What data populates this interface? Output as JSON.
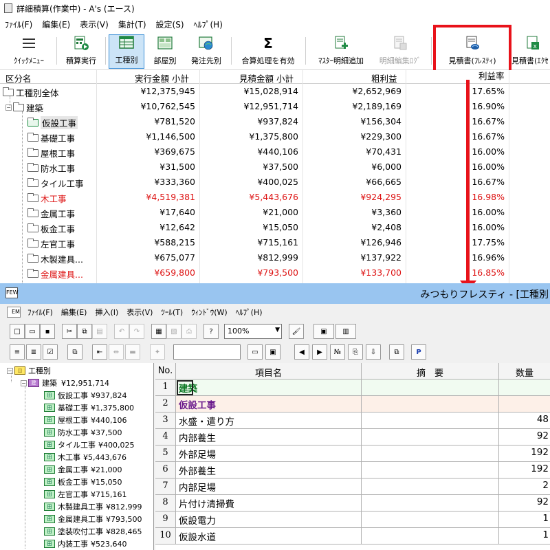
{
  "top": {
    "title": "詳細積算(作業中) - A's (エース)",
    "menu": [
      "ﾌｧｲﾙ(F)",
      "編集(E)",
      "表示(V)",
      "集計(T)",
      "設定(S)",
      "ﾍﾙﾌﾟ(H)"
    ],
    "toolbar": {
      "quick_menu": "ｸｲｯｸﾒﾆｭｰ",
      "estimate_run": "積算実行",
      "by_trade": "工種別",
      "by_room": "部屋別",
      "by_order": "発注先別",
      "sum_enable": "合算処理を有効",
      "master_add": "ﾏｽﾀｰ明細追加",
      "detail_log": "明細編集ﾛｸﾞ",
      "estimate_fresty": "見積書(ﾌﾚｽﾃｨ)",
      "estimate_excel": "見積書(ｴｸｾ"
    },
    "headers": {
      "category": "区分名",
      "exec_amount": "実行金額 小計",
      "est_amount": "見積金額 小計",
      "gross_profit": "粗利益",
      "margin": "利益率"
    },
    "rows": [
      {
        "name": "工種別全体",
        "exec": "¥12,375,945",
        "est": "¥15,028,914",
        "profit": "¥2,652,969",
        "rate": "17.65%",
        "level": 0
      },
      {
        "name": "建築",
        "exec": "¥10,762,545",
        "est": "¥12,951,714",
        "profit": "¥2,189,169",
        "rate": "16.90%",
        "level": 1
      },
      {
        "name": "仮設工事",
        "exec": "¥781,520",
        "est": "¥937,824",
        "profit": "¥156,304",
        "rate": "16.67%",
        "level": 2,
        "selected": true
      },
      {
        "name": "基礎工事",
        "exec": "¥1,146,500",
        "est": "¥1,375,800",
        "profit": "¥229,300",
        "rate": "16.67%",
        "level": 2
      },
      {
        "name": "屋根工事",
        "exec": "¥369,675",
        "est": "¥440,106",
        "profit": "¥70,431",
        "rate": "16.00%",
        "level": 2
      },
      {
        "name": "防水工事",
        "exec": "¥31,500",
        "est": "¥37,500",
        "profit": "¥6,000",
        "rate": "16.00%",
        "level": 2
      },
      {
        "name": "タイル工事",
        "exec": "¥333,360",
        "est": "¥400,025",
        "profit": "¥66,665",
        "rate": "16.67%",
        "level": 2
      },
      {
        "name": "木工事",
        "exec": "¥4,519,381",
        "est": "¥5,443,676",
        "profit": "¥924,295",
        "rate": "16.98%",
        "level": 2,
        "red": true
      },
      {
        "name": "金属工事",
        "exec": "¥17,640",
        "est": "¥21,000",
        "profit": "¥3,360",
        "rate": "16.00%",
        "level": 2
      },
      {
        "name": "板金工事",
        "exec": "¥12,642",
        "est": "¥15,050",
        "profit": "¥2,408",
        "rate": "16.00%",
        "level": 2
      },
      {
        "name": "左官工事",
        "exec": "¥588,215",
        "est": "¥715,161",
        "profit": "¥126,946",
        "rate": "17.75%",
        "level": 2
      },
      {
        "name": "木製建具...",
        "exec": "¥675,077",
        "est": "¥812,999",
        "profit": "¥137,922",
        "rate": "16.96%",
        "level": 2
      },
      {
        "name": "金属建具...",
        "exec": "¥659,800",
        "est": "¥793,500",
        "profit": "¥133,700",
        "rate": "16.85%",
        "level": 2,
        "red": true
      }
    ]
  },
  "bottom": {
    "title": "みつもりフレスティ - [工種別",
    "menu": [
      "ﾌｧｲﾙ(F)",
      "編集(E)",
      "挿入(I)",
      "表示(V)",
      "ﾂｰﾙ(T)",
      "ｳｨﾝﾄﾞｳ(W)",
      "ﾍﾙﾌﾟ(H)"
    ],
    "zoom": "100%",
    "tree": {
      "root": "工種別",
      "group": "建築",
      "group_amount": "¥12,951,714",
      "items": [
        {
          "name": "仮設工事",
          "amount": "¥937,824"
        },
        {
          "name": "基礎工事",
          "amount": "¥1,375,800"
        },
        {
          "name": "屋根工事",
          "amount": "¥440,106"
        },
        {
          "name": "防水工事",
          "amount": "¥37,500"
        },
        {
          "name": "タイル工事",
          "amount": "¥400,025"
        },
        {
          "name": "木工事",
          "amount": "¥5,443,676"
        },
        {
          "name": "金属工事",
          "amount": "¥21,000"
        },
        {
          "name": "板金工事",
          "amount": "¥15,050"
        },
        {
          "name": "左官工事",
          "amount": "¥715,161"
        },
        {
          "name": "木製建具工事",
          "amount": "¥812,999"
        },
        {
          "name": "金属建具工事",
          "amount": "¥793,500"
        },
        {
          "name": "塗装吹付工事",
          "amount": "¥828,465"
        },
        {
          "name": "内装工事",
          "amount": "¥523,640"
        }
      ]
    },
    "grid": {
      "headers": {
        "no": "No.",
        "item": "項目名",
        "summary": "摘　要",
        "qty": "数量"
      },
      "rows": [
        {
          "no": "1",
          "item": "建築",
          "qty": "",
          "style": "group"
        },
        {
          "no": "2",
          "item": "仮設工事",
          "qty": "",
          "style": "sub"
        },
        {
          "no": "3",
          "item": "水盛・遣り方",
          "qty": "48"
        },
        {
          "no": "4",
          "item": "内部養生",
          "qty": "92"
        },
        {
          "no": "5",
          "item": "外部足場",
          "qty": "192"
        },
        {
          "no": "6",
          "item": "外部養生",
          "qty": "192"
        },
        {
          "no": "7",
          "item": "内部足場",
          "qty": "2"
        },
        {
          "no": "8",
          "item": "片付け清掃費",
          "qty": "92"
        },
        {
          "no": "9",
          "item": "仮設電力",
          "qty": "1"
        },
        {
          "no": "10",
          "item": "仮設水道",
          "qty": "1"
        }
      ]
    }
  }
}
